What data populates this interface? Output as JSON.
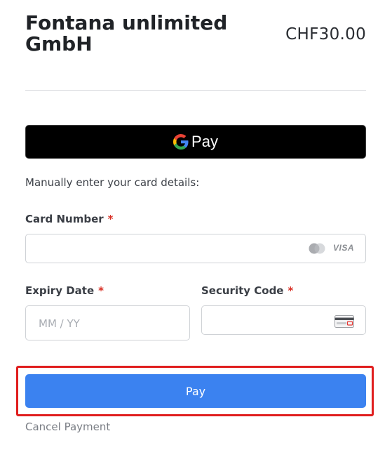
{
  "header": {
    "merchant_name": "Fontana unlimited GmbH",
    "amount": "CHF30.00"
  },
  "google_pay": {
    "label": "Pay",
    "icon": "google-g-icon"
  },
  "manual_entry": {
    "prompt": "Manually enter your card details:"
  },
  "card_number": {
    "label": "Card Number",
    "required_mark": "*",
    "value": "",
    "placeholder": "",
    "brands": [
      "mastercard-icon",
      "VISA"
    ]
  },
  "expiry": {
    "label": "Expiry Date",
    "required_mark": "*",
    "value": "",
    "placeholder": "MM / YY"
  },
  "security_code": {
    "label": "Security Code",
    "required_mark": "*",
    "value": "",
    "placeholder": "",
    "icon": "card-cvc-icon"
  },
  "pay_button": {
    "label": "Pay",
    "color": "#3b82f0"
  },
  "cancel": {
    "label": "Cancel Payment"
  },
  "colors": {
    "highlight": "#e01e1e",
    "required": "#d93025"
  }
}
